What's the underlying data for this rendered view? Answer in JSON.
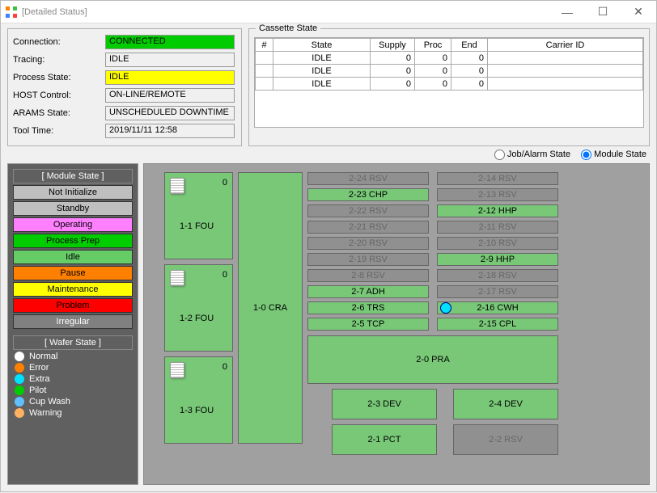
{
  "window": {
    "title": "[Detailed Status]"
  },
  "status": {
    "connection_lbl": "Connection:",
    "connection": "CONNECTED",
    "tracing_lbl": "Tracing:",
    "tracing": "IDLE",
    "process_state_lbl": "Process State:",
    "process_state": "IDLE",
    "host_lbl": "HOST Control:",
    "host": "ON-LINE/REMOTE",
    "arams_lbl": "ARAMS State:",
    "arams": "UNSCHEDULED DOWNTIME",
    "tooltime_lbl": "Tool Time:",
    "tooltime": "2019/11/11  12:58"
  },
  "cassette": {
    "legend": "Cassette State",
    "headers": {
      "num": "#",
      "state": "State",
      "supply": "Supply",
      "proc": "Proc",
      "end": "End",
      "carrier": "Carrier ID"
    },
    "rows": [
      {
        "state": "IDLE",
        "supply": "0",
        "proc": "0",
        "end": "0",
        "carrier": ""
      },
      {
        "state": "IDLE",
        "supply": "0",
        "proc": "0",
        "end": "0",
        "carrier": ""
      },
      {
        "state": "IDLE",
        "supply": "0",
        "proc": "0",
        "end": "0",
        "carrier": ""
      }
    ]
  },
  "radio": {
    "jobalarm": "Job/Alarm State",
    "module": "Module State"
  },
  "module_state_legend": {
    "title": "[ Module State ]",
    "items": {
      "not_initialize": "Not Initialize",
      "standby": "Standby",
      "operating": "Operating",
      "process_prep": "Process Prep",
      "idle": "Idle",
      "pause": "Pause",
      "maintenance": "Maintenance",
      "problem": "Problem",
      "irregular": "Irregular"
    }
  },
  "wafer_state_legend": {
    "title": "[ Wafer State ]",
    "items": {
      "normal": {
        "label": "Normal",
        "color": "#ffffff"
      },
      "error": {
        "label": "Error",
        "color": "#ff7f00"
      },
      "extra": {
        "label": "Extra",
        "color": "#00e0ff"
      },
      "pilot": {
        "label": "Pilot",
        "color": "#00cc00"
      },
      "cupwash": {
        "label": "Cup Wash",
        "color": "#60c0ff"
      },
      "warning": {
        "label": "Warning",
        "color": "#ffb060"
      }
    }
  },
  "fou": {
    "f1": {
      "label": "1-1 FOU",
      "count": "0"
    },
    "f2": {
      "label": "1-2 FOU",
      "count": "0"
    },
    "f3": {
      "label": "1-3 FOU",
      "count": "0"
    }
  },
  "cra": {
    "label": "1-0 CRA"
  },
  "modules": {
    "m224": "2-24 RSV",
    "m214": "2-14 RSV",
    "m223": "2-23 CHP",
    "m213": "2-13 RSV",
    "m222": "2-22 RSV",
    "m212": "2-12 HHP",
    "m221": "2-21 RSV",
    "m211": "2-11 RSV",
    "m220": "2-20 RSV",
    "m210": "2-10 RSV",
    "m219": "2-19 RSV",
    "m29": "2-9 HHP",
    "m28": "2-8 RSV",
    "m218": "2-18 RSV",
    "m27": "2-7 ADH",
    "m217": "2-17 RSV",
    "m26": "2-6 TRS",
    "m216": "2-16 CWH",
    "m25": "2-5 TCP",
    "m215": "2-15 CPL",
    "m20": "2-0 PRA",
    "m23": "2-3 DEV",
    "m24": "2-4 DEV",
    "m21": "2-1 PCT",
    "m22": "2-2 RSV"
  }
}
